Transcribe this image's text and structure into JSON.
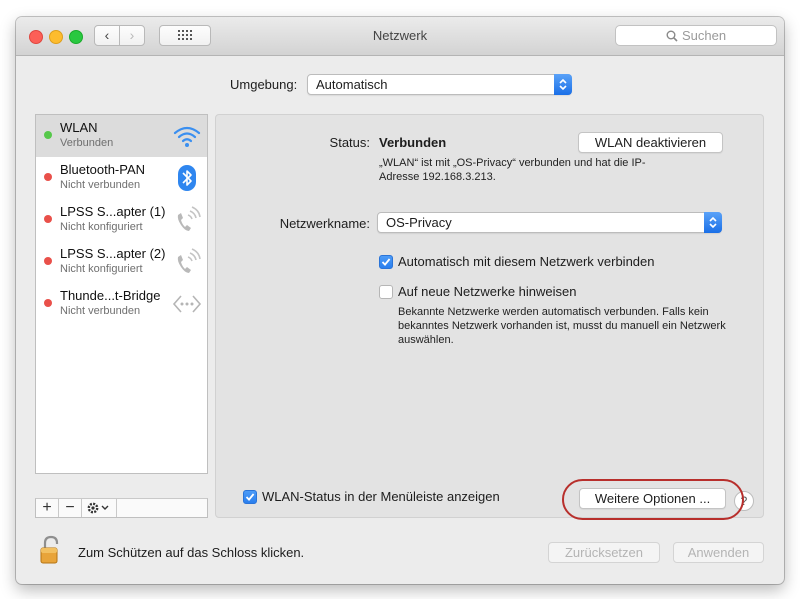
{
  "window": {
    "title": "Netzwerk"
  },
  "toolbar": {
    "search_placeholder": "Suchen"
  },
  "location": {
    "label": "Umgebung:",
    "value": "Automatisch"
  },
  "services": [
    {
      "name": "WLAN",
      "status": "Verbunden",
      "state": "connected",
      "icon": "wifi-icon"
    },
    {
      "name": "Bluetooth-PAN",
      "status": "Nicht verbunden",
      "state": "disconnected",
      "icon": "bluetooth-icon"
    },
    {
      "name": "LPSS S...apter (1)",
      "status": "Nicht konfiguriert",
      "state": "disconnected",
      "icon": "phone-icon"
    },
    {
      "name": "LPSS S...apter (2)",
      "status": "Nicht konfiguriert",
      "state": "disconnected",
      "icon": "phone-icon"
    },
    {
      "name": "Thunde...t-Bridge",
      "status": "Nicht verbunden",
      "state": "disconnected",
      "icon": "bridge-icon"
    }
  ],
  "sidebar_toolbar": {
    "add": "+",
    "remove": "−"
  },
  "detail": {
    "status_label": "Status:",
    "status_value": "Verbunden",
    "toggle_button": "WLAN deaktivieren",
    "status_info": "„WLAN“ ist mit „OS-Privacy“ verbunden und hat die IP-Adresse 192.168.3.213.",
    "network_name_label": "Netzwerkname:",
    "network_name_value": "OS-Privacy",
    "auto_join_label": "Automatisch mit diesem Netzwerk verbinden",
    "auto_join_checked": true,
    "ask_new_label": "Auf neue Netzwerke hinweisen",
    "ask_new_checked": false,
    "ask_new_help": "Bekannte Netzwerke werden automatisch verbunden. Falls kein bekanntes Netzwerk vorhanden ist, musst du manuell ein Netzwerk auswählen.",
    "menubar_label": "WLAN-Status in der Menüleiste anzeigen",
    "menubar_checked": true,
    "advanced_button": "Weitere Optionen ...",
    "help_button": "?"
  },
  "footer": {
    "lock_text": "Zum Schützen auf das Schloss klicken.",
    "revert_button": "Zurücksetzen",
    "apply_button": "Anwenden"
  },
  "colors": {
    "connected": "#56c84a",
    "disconnected": "#e9504a",
    "accent": "#2a7fee",
    "highlight_ring": "#b82f2c"
  }
}
